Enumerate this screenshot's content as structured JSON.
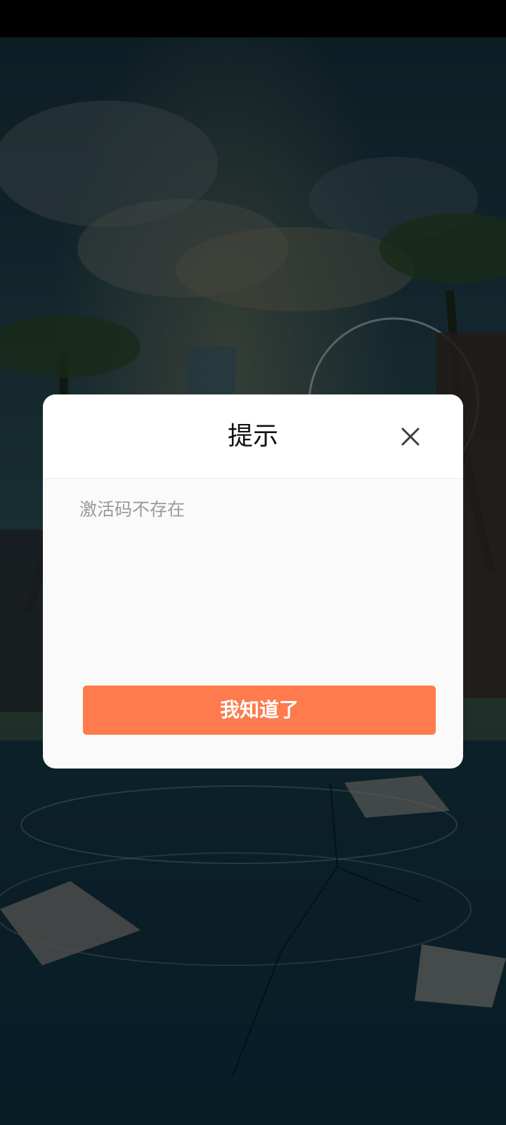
{
  "dialog": {
    "title": "提示",
    "message": "激活码不存在",
    "confirm_label": "我知道了"
  },
  "icons": {
    "close": "close-icon"
  },
  "colors": {
    "confirm_button": "#ff7a4d",
    "overlay": "rgba(0,0,0,0.42)",
    "dialog_background": "#fafafa",
    "message_text": "#9a9a9a"
  }
}
